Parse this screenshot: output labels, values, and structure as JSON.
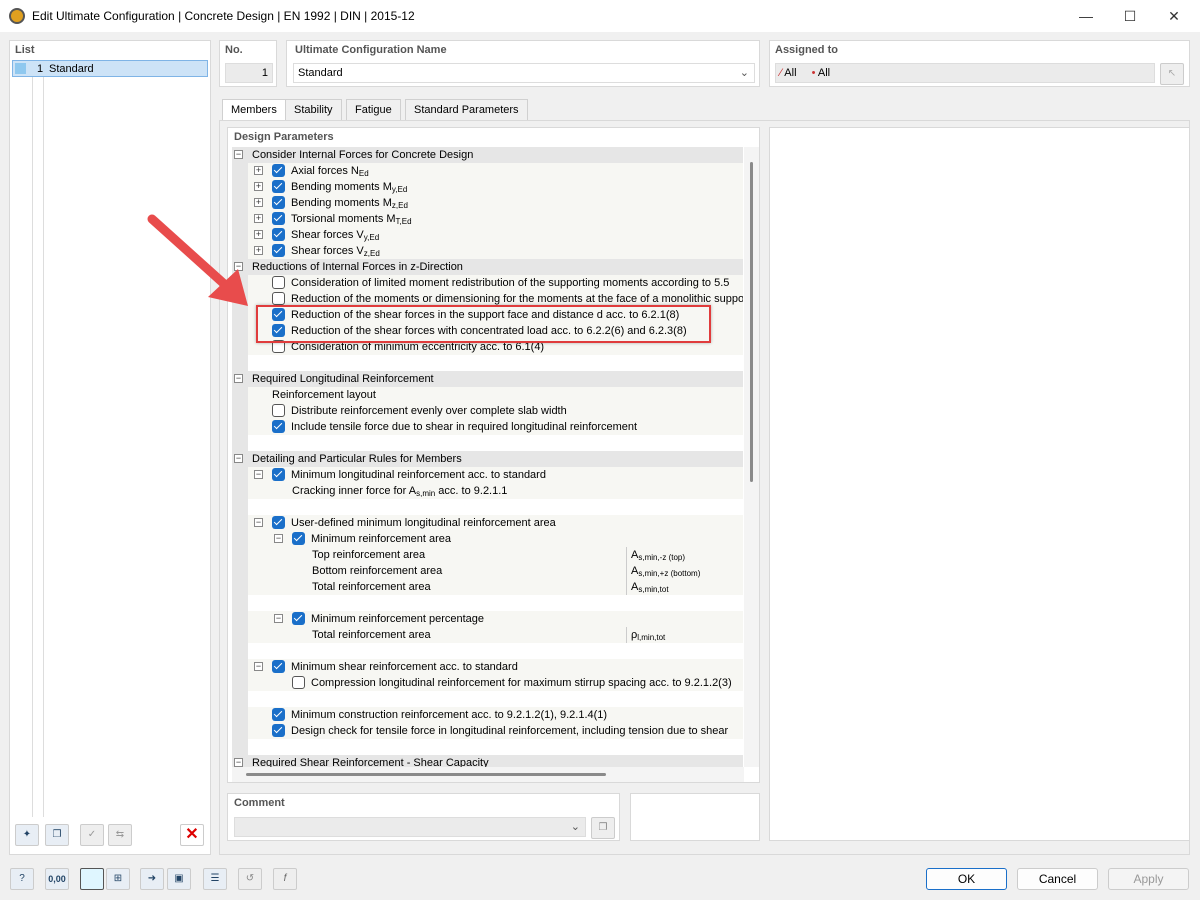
{
  "window": {
    "title": "Edit Ultimate Configuration | Concrete Design | EN 1992 | DIN | 2015-12"
  },
  "list": {
    "header": "List",
    "items": [
      {
        "no": "1",
        "name": "Standard"
      }
    ]
  },
  "no": {
    "header": "No.",
    "value": "1"
  },
  "name": {
    "header": "Ultimate Configuration Name",
    "value": "Standard"
  },
  "assigned": {
    "header": "Assigned to",
    "value1": "All",
    "value2": "All"
  },
  "tabs": [
    "Members",
    "Stability",
    "Fatigue",
    "Standard Parameters"
  ],
  "design_params": {
    "header": "Design Parameters",
    "rows": [
      {
        "type": "sec",
        "label": "Consider Internal Forces for Concrete Design"
      },
      {
        "lvl": 1,
        "exp": "+",
        "cb": true,
        "label": "Axial forces N",
        "sub": "Ed"
      },
      {
        "lvl": 1,
        "exp": "+",
        "cb": true,
        "label": "Bending moments M",
        "sub": "y,Ed"
      },
      {
        "lvl": 1,
        "exp": "+",
        "cb": true,
        "label": "Bending moments M",
        "sub": "z,Ed"
      },
      {
        "lvl": 1,
        "exp": "+",
        "cb": true,
        "label": "Torsional moments M",
        "sub": "T,Ed"
      },
      {
        "lvl": 1,
        "exp": "+",
        "cb": true,
        "label": "Shear forces V",
        "sub": "y,Ed"
      },
      {
        "lvl": 1,
        "exp": "+",
        "cb": true,
        "label": "Shear forces V",
        "sub": "z,Ed"
      },
      {
        "type": "sec",
        "label": "Reductions of Internal Forces in z-Direction"
      },
      {
        "lvl": 1,
        "cb": false,
        "label": "Consideration of limited moment redistribution of the supporting moments according to 5.5"
      },
      {
        "lvl": 1,
        "cb": false,
        "label": "Reduction of the moments or dimensioning for the moments at the face of a monolithic support"
      },
      {
        "lvl": 1,
        "cb": true,
        "label": "Reduction of the shear forces in the support face and distance d acc. to 6.2.1(8)"
      },
      {
        "lvl": 1,
        "cb": true,
        "label": "Reduction of the shear forces with concentrated load acc. to 6.2.2(6) and 6.2.3(8)"
      },
      {
        "lvl": 1,
        "cb": false,
        "label": "Consideration of minimum eccentricity acc. to 6.1(4)"
      },
      {
        "type": "blank"
      },
      {
        "type": "sec",
        "label": "Required Longitudinal Reinforcement"
      },
      {
        "lvl": 1,
        "label": "Reinforcement layout"
      },
      {
        "lvl": 1,
        "cb": false,
        "label": "Distribute reinforcement evenly over complete slab width"
      },
      {
        "lvl": 1,
        "cb": true,
        "label": "Include tensile force due to shear in required longitudinal reinforcement"
      },
      {
        "type": "blank"
      },
      {
        "type": "sec",
        "label": "Detailing and Particular Rules for Members"
      },
      {
        "lvl": 1,
        "exp": "-",
        "cb": true,
        "label": "Minimum longitudinal reinforcement acc. to standard"
      },
      {
        "lvl": 2,
        "label": "Cracking inner force for A",
        "sub": "s,min",
        "after": " acc. to 9.2.1.1"
      },
      {
        "type": "blank"
      },
      {
        "lvl": 1,
        "exp": "-",
        "cb": true,
        "label": "User-defined minimum longitudinal reinforcement area"
      },
      {
        "lvl": 2,
        "exp": "-",
        "cb": true,
        "label": "Minimum reinforcement area"
      },
      {
        "lvl": 3,
        "label": "Top reinforcement area",
        "val": "A",
        "valsub": "s,min,-z (top)"
      },
      {
        "lvl": 3,
        "label": "Bottom reinforcement area",
        "val": "A",
        "valsub": "s,min,+z (bottom)"
      },
      {
        "lvl": 3,
        "label": "Total reinforcement area",
        "val": "A",
        "valsub": "s,min,tot"
      },
      {
        "type": "blank"
      },
      {
        "lvl": 2,
        "exp": "-",
        "cb": true,
        "label": "Minimum reinforcement percentage"
      },
      {
        "lvl": 3,
        "label": "Total reinforcement area",
        "val": "ρ",
        "valsub": "l,min,tot"
      },
      {
        "type": "blank"
      },
      {
        "lvl": 1,
        "exp": "-",
        "cb": true,
        "label": "Minimum shear reinforcement acc. to standard"
      },
      {
        "lvl": 2,
        "cb": false,
        "label": "Compression longitudinal reinforcement for maximum stirrup spacing acc. to 9.2.1.2(3)"
      },
      {
        "type": "blank"
      },
      {
        "lvl": 1,
        "cb": true,
        "label": "Minimum construction reinforcement acc. to 9.2.1.2(1), 9.2.1.4(1)"
      },
      {
        "lvl": 1,
        "cb": true,
        "label": "Design check for tensile force in longitudinal reinforcement, including tension due to shear"
      },
      {
        "type": "blank"
      },
      {
        "type": "sec",
        "label": "Required Shear Reinforcement - Shear Capacity"
      }
    ]
  },
  "comment": {
    "header": "Comment",
    "value": ""
  },
  "buttons": {
    "ok": "OK",
    "cancel": "Cancel",
    "apply": "Apply"
  },
  "toolbar": {
    "decimal_label": "0,00"
  },
  "colors": {
    "highlight": "#e03c3c",
    "accent": "#1a6fc9"
  }
}
